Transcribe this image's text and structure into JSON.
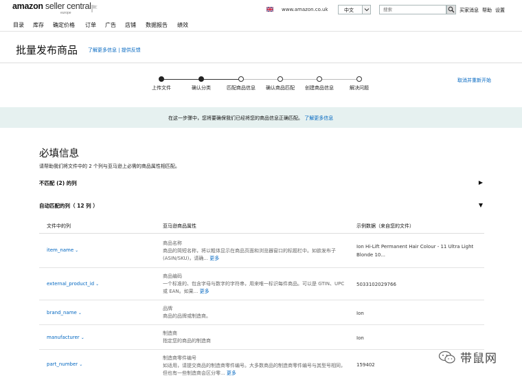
{
  "header": {
    "logo_main": "amazon",
    "logo_light": " seller central",
    "logo_sub": "europe",
    "domain": "www.amazon.co.uk",
    "language": "中文",
    "search_placeholder": "搜索",
    "links": [
      "买家消息",
      "帮助",
      "设置"
    ]
  },
  "nav": {
    "items": [
      "目录",
      "库存",
      "确定价格",
      "订单",
      "广告",
      "店铺",
      "数据报告",
      "绩效"
    ]
  },
  "page": {
    "title": "批量发布商品",
    "links": "了解更多信息 | 提供反馈"
  },
  "stepper": {
    "steps": [
      {
        "label": "上传文件",
        "state": "done"
      },
      {
        "label": "确认分类",
        "state": "done"
      },
      {
        "label": "匹配商品信息",
        "state": "todo"
      },
      {
        "label": "确认商品匹配",
        "state": "todo"
      },
      {
        "label": "创建商品信息",
        "state": "todo"
      },
      {
        "label": "解决问题",
        "state": "todo"
      }
    ],
    "restart": "取消并重新开始"
  },
  "banner": {
    "text": "在这一步骤中，您将要确保我们已经将您的商品信息正确匹配。",
    "link": "了解更多信息"
  },
  "section": {
    "title": "必填信息",
    "desc": "请帮助我们将文件中的 2 个列与亚马逊上必需的商品属性相匹配。",
    "unmatched": "不匹配 (2) 的列",
    "auto_matched": "自动匹配的列（ 12 列 ）"
  },
  "table": {
    "headers": [
      "文件中的列",
      "亚马逊商品属性",
      "示例数据（来自您的文件）"
    ],
    "rows": [
      {
        "name": "item_name",
        "attr_title": "商品名称",
        "attr_desc": "商品的简短名称，将以粗体显示在商品页面和浏览器窗口的标题栏中。如欲发布子 (ASIN/SKU)，请确...",
        "sample": "Ion Hi-Lift Permanent Hair Colour - 11 Ultra Light Blonde 10..."
      },
      {
        "name": "external_product_id",
        "attr_title": "商品编码",
        "attr_desc": "一个标准的、包含字母与数字的字符串，用来唯一标识每件商品。可以是 GTIN、UPC 或 EAN。如果...",
        "sample": "5033102029766"
      },
      {
        "name": "brand_name",
        "attr_title": "品牌",
        "attr_desc": "商品的品牌或制造商。",
        "sample": "Ion"
      },
      {
        "name": "manufacturer",
        "attr_title": "制造商",
        "attr_desc": "指定您的商品的制造商",
        "sample": "Ion"
      },
      {
        "name": "part_number",
        "attr_title": "制造商零件编号",
        "attr_desc": "如适用，请提交商品的制造商零件编号。大多数商品的制造商零件编号与其型号相同，但也有一些制造商会区分零...",
        "sample": "159402"
      }
    ],
    "more_label": "更多"
  },
  "watermark": {
    "text": "带鼠网"
  }
}
